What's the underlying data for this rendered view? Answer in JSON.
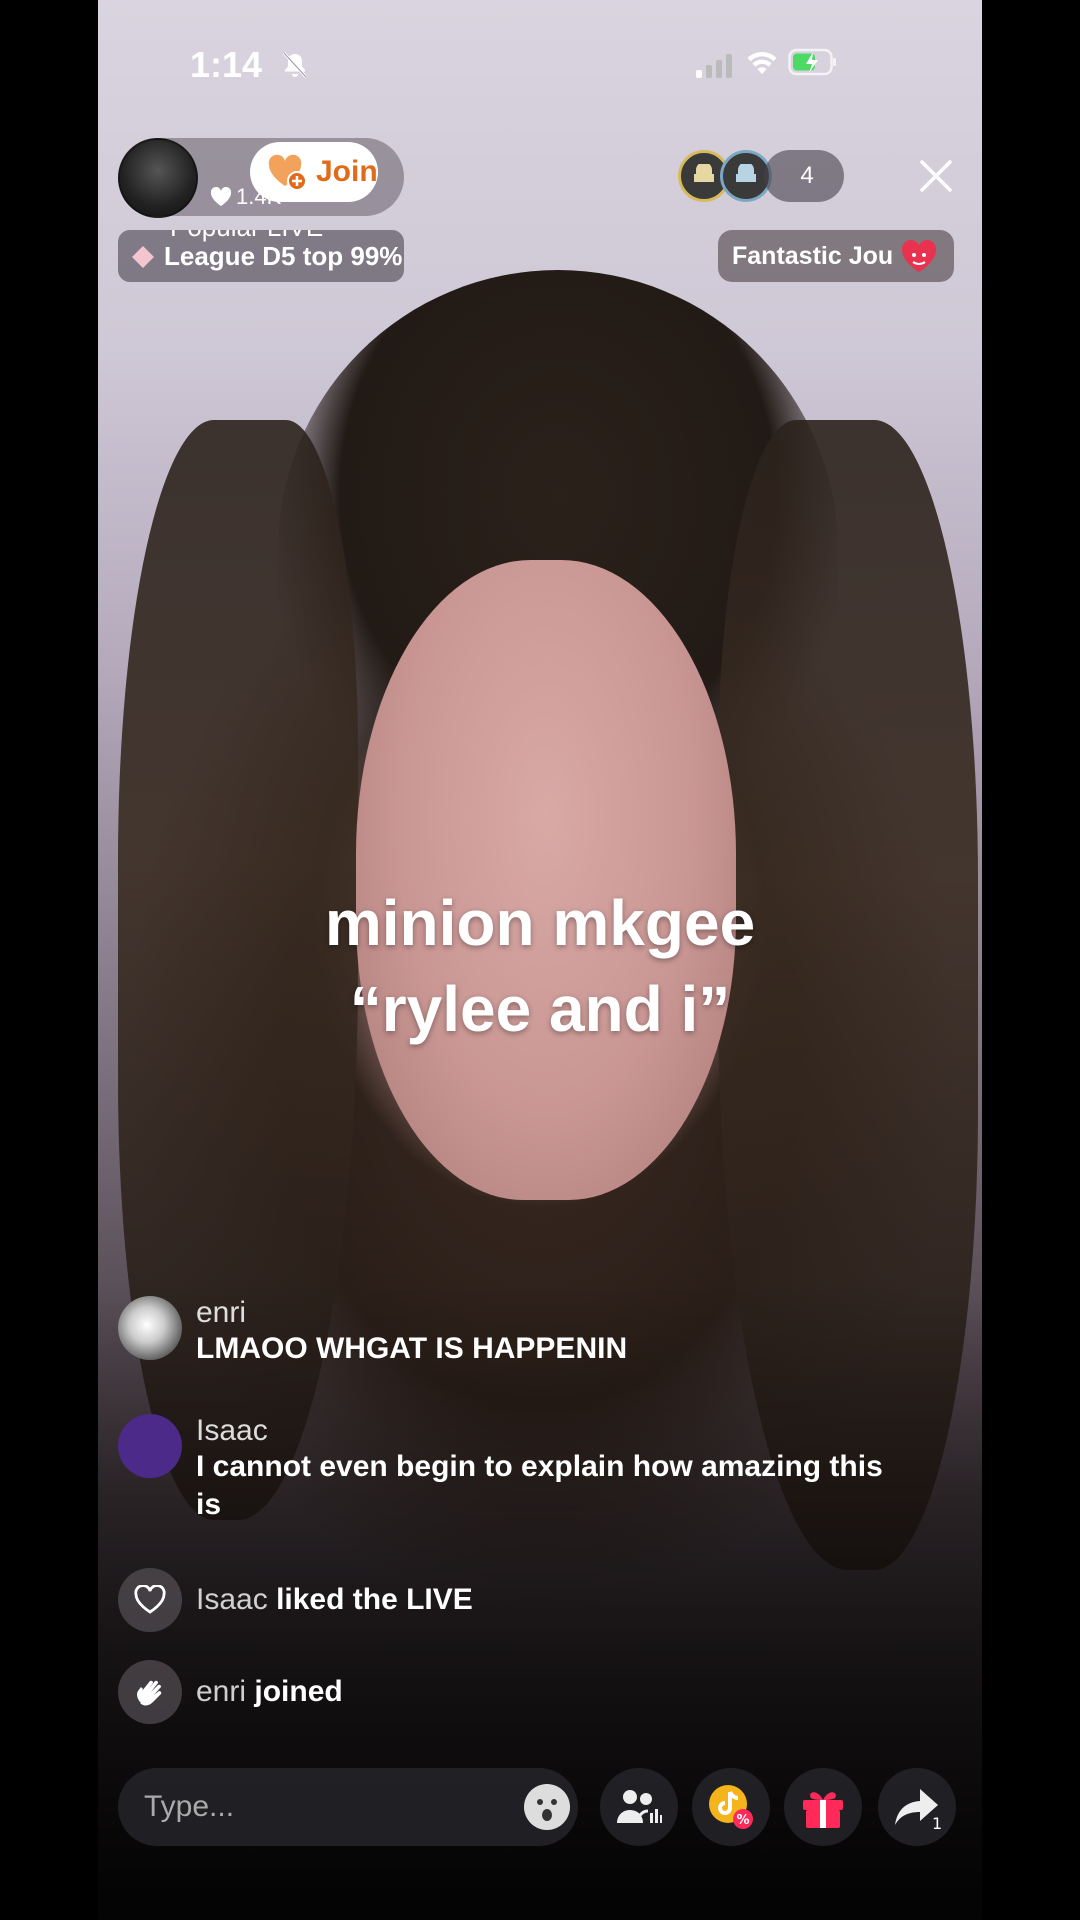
{
  "status_bar": {
    "time": "1:14"
  },
  "host": {
    "likes": "1.4K",
    "join_label": "Join",
    "popular": "Popular LIVE",
    "league": "League D5 top 99%"
  },
  "viewers": {
    "count": "4"
  },
  "rank": {
    "label": "Fantastic Jou"
  },
  "caption": {
    "line1": "minion mkgee",
    "line2": "“rylee and i”"
  },
  "chat": [
    {
      "user": "enri",
      "message": "LMAOO WHGAT IS HAPPENIN"
    },
    {
      "user": "Isaac",
      "message": "I cannot even begin to explain how amazing this is"
    }
  ],
  "events": [
    {
      "user": "Isaac",
      "text": "liked the LIVE",
      "icon": "heart-icon"
    },
    {
      "user": "enri",
      "text": "joined",
      "icon": "wave-icon"
    }
  ],
  "bottom": {
    "placeholder": "Type...",
    "share_count": "1"
  },
  "colors": {
    "join_accent": "#e06b1a",
    "gift": "#ff2a5a",
    "isaac_avatar": "#4b2a8a"
  }
}
